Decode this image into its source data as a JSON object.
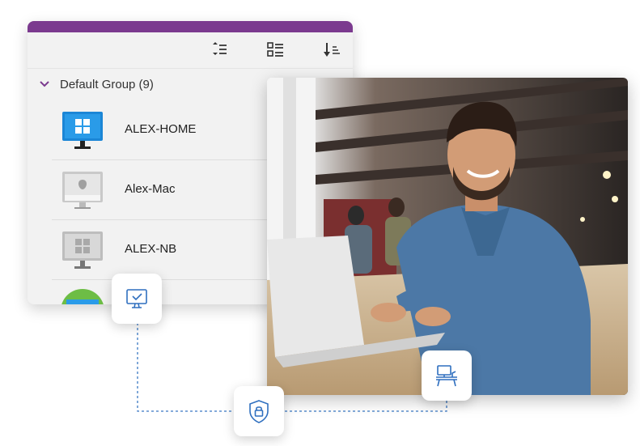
{
  "toolbar": {
    "icons": [
      "sort-order-icon",
      "list-view-icon",
      "sort-descending-icon"
    ]
  },
  "group": {
    "label": "Default Group (9)"
  },
  "devices": [
    {
      "name": "ALEX-HOME",
      "icon": "windows-monitor-icon"
    },
    {
      "name": "Alex-Mac",
      "icon": "imac-icon"
    },
    {
      "name": "ALEX-NB",
      "icon": "windows-monitor-offline-icon"
    }
  ],
  "badges": [
    "monitor-check-icon",
    "shield-lock-icon",
    "workstation-icon"
  ],
  "colors": {
    "accent_bar": "#7b3a8f",
    "badge_icon": "#2f6fbf",
    "connector": "#2f6fbf"
  }
}
